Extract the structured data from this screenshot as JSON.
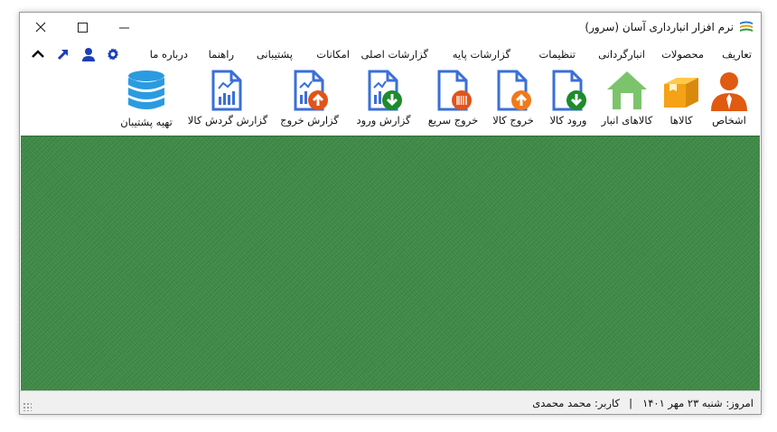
{
  "window": {
    "title": "نرم افزار انبارداری آسان (سرور)",
    "minimize_glyph": "—",
    "maximize_glyph": "☐",
    "close_glyph": "✕"
  },
  "menu": {
    "items": [
      "تعاریف",
      "محصولات",
      "انبارگردانی",
      "تنظیمات",
      "گزارشات پایه",
      "گزارشات اصلی",
      "امکانات",
      "پشتیبانی",
      "راهنما",
      "درباره ما"
    ]
  },
  "quick_icons": [
    "gear-icon",
    "user-icon",
    "arrow-up-right-icon",
    "chevron-up-icon"
  ],
  "toolbar": {
    "items": [
      {
        "label": "اشخاص",
        "icon": "person-icon"
      },
      {
        "label": "کالاها",
        "icon": "box-icon"
      },
      {
        "label": "کالاهای انبار",
        "icon": "warehouse-icon"
      },
      {
        "label": "ورود کالا",
        "icon": "document-in-icon"
      },
      {
        "label": "خروج کالا",
        "icon": "document-out-icon"
      },
      {
        "label": "خروج سریع",
        "icon": "document-barcode-icon"
      },
      {
        "label": "گزارش ورود",
        "icon": "report-in-icon"
      },
      {
        "label": "گزارش خروج",
        "icon": "report-out-icon"
      },
      {
        "label": "گزارش گردش کالا",
        "icon": "report-icon"
      },
      {
        "label": "تهیه پشتیبان",
        "icon": "database-icon"
      }
    ]
  },
  "status": {
    "today": "امروز: شنبه ۲۳ مهر ۱۴۰۱",
    "separator": "|",
    "user": "کاربر: محمد محمدی"
  },
  "colors": {
    "icon_blue": "#3a6fd8",
    "accent_green": "#2e9b3a",
    "accent_orange": "#f07a1a",
    "content_green": "#3f8a47"
  }
}
